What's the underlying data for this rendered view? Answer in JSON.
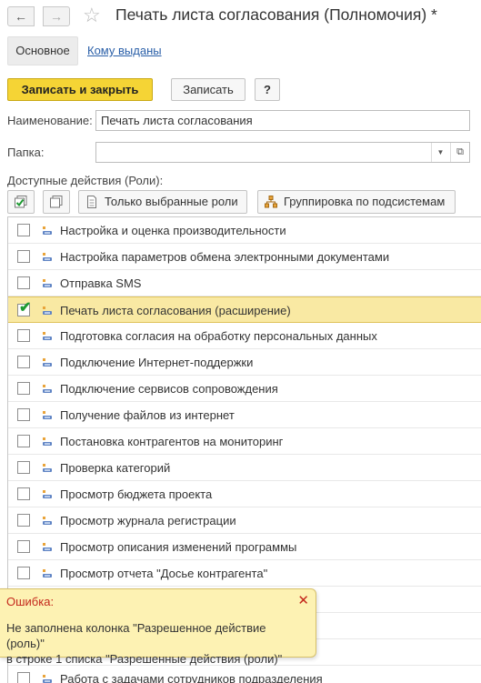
{
  "header": {
    "back_icon": "←",
    "forward_icon": "→",
    "favorite_icon": "☆",
    "title": "Печать листа согласования (Полномочия) *"
  },
  "tabs": {
    "main": "Основное",
    "issued_to": "Кому выданы"
  },
  "toolbar": {
    "save_and_close": "Записать и закрыть",
    "save": "Записать",
    "help": "?"
  },
  "form": {
    "name_label": "Наименование:",
    "name_value": "Печать листа согласования",
    "folder_label": "Папка:",
    "folder_value": "",
    "folder_dropdown_icon": "▼",
    "folder_open_icon": "⧉",
    "roles_label": "Доступные действия (Роли):"
  },
  "roles_toolbar": {
    "only_selected": "Только выбранные роли",
    "group_by_subsystem": "Группировка по подсистемам"
  },
  "roles": [
    {
      "label": "Настройка и оценка производительности",
      "checked": false
    },
    {
      "label": "Настройка параметров обмена электронными документами",
      "checked": false
    },
    {
      "label": "Отправка SMS",
      "checked": false
    },
    {
      "label": "Печать листа согласования (расширение)",
      "checked": true
    },
    {
      "label": "Подготовка согласия на обработку персональных данных",
      "checked": false
    },
    {
      "label": "Подключение Интернет-поддержки",
      "checked": false
    },
    {
      "label": "Подключение сервисов сопровождения",
      "checked": false
    },
    {
      "label": "Получение файлов из интернет",
      "checked": false
    },
    {
      "label": "Постановка контрагентов на мониторинг",
      "checked": false
    },
    {
      "label": "Проверка категорий",
      "checked": false
    },
    {
      "label": "Просмотр бюджета проекта",
      "checked": false
    },
    {
      "label": "Просмотр журнала регистрации",
      "checked": false
    },
    {
      "label": "Просмотр описания изменений программы",
      "checked": false
    },
    {
      "label": "Просмотр отчета \"Досье контрагента\"",
      "checked": false
    },
    {
      "label": "",
      "checked": false
    },
    {
      "label": "",
      "checked": false
    },
    {
      "label": "",
      "checked": false
    },
    {
      "label": "Работа с задачами сотрудников подразделения",
      "checked": false
    }
  ],
  "error": {
    "title": "Ошибка:",
    "close_icon": "✕",
    "line1": "Не заполнена колонка \"Разрешенное действие (роль)\"",
    "line2": "в строке 1 списка \"Разрешенные действия (роли)\""
  },
  "colors": {
    "accent_yellow": "#f5d435",
    "selected_row": "#f9e9a3",
    "error_bg": "#fdf2b3",
    "error_text": "#c4281c",
    "link": "#2a5fa8",
    "check_green": "#1e9a32"
  }
}
